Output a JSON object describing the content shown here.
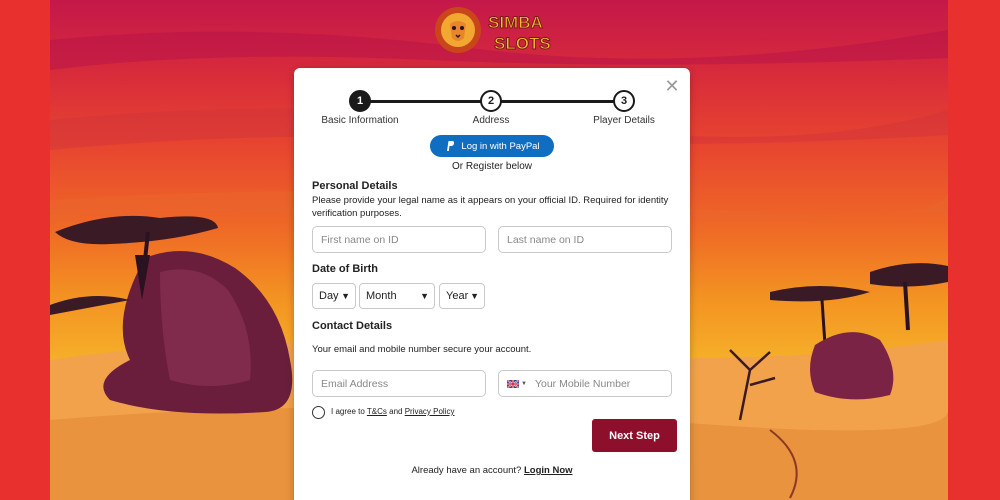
{
  "brand": {
    "logo_line1": "SIMBA",
    "logo_line2": "SLOTS"
  },
  "stepper": {
    "steps": [
      {
        "number": "1",
        "label": "Basic Information",
        "state": "active"
      },
      {
        "number": "2",
        "label": "Address",
        "state": "upcoming"
      },
      {
        "number": "3",
        "label": "Player Details",
        "state": "upcoming"
      }
    ]
  },
  "paypal": {
    "label": "Log in with PayPal",
    "icon": "paypal-icon"
  },
  "or_register": "Or Register below",
  "personal": {
    "title": "Personal Details",
    "description": "Please provide your legal name as it appears on your official ID. Required for identity verification purposes.",
    "first_name_placeholder": "First name on ID",
    "last_name_placeholder": "Last name on ID"
  },
  "dob": {
    "title": "Date of Birth",
    "day": "Day",
    "month": "Month",
    "year": "Year"
  },
  "contact": {
    "title": "Contact Details",
    "description": "Your email and mobile number secure your account.",
    "email_placeholder": "Email Address",
    "mobile_placeholder": "Your Mobile Number",
    "country_flag": "uk-flag-icon"
  },
  "agree": {
    "prefix": "I agree to ",
    "tcs": "T&Cs",
    "and": " and ",
    "privacy": "Privacy Policy"
  },
  "next_button": "Next Step",
  "footer": {
    "prompt": "Already have an account? ",
    "login": "Login Now"
  },
  "colors": {
    "primary": "#8d0f2c",
    "paypal": "#0f6ec2",
    "page_bg": "#e8312f"
  }
}
